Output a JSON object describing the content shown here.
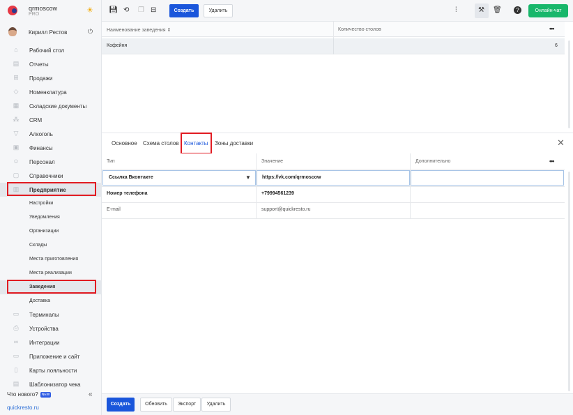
{
  "app": {
    "name": "qrmoscow",
    "plan": "PRO"
  },
  "user": {
    "name": "Кирилл Рестов"
  },
  "sidebar": {
    "items": [
      {
        "label": "Рабочий стол",
        "icon": "home-icon"
      },
      {
        "label": "Отчеты",
        "icon": "chart-icon"
      },
      {
        "label": "Продажи",
        "icon": "cart-icon"
      },
      {
        "label": "Номенклатура",
        "icon": "tag-icon"
      },
      {
        "label": "Складские документы",
        "icon": "warehouse-icon"
      },
      {
        "label": "CRM",
        "icon": "people-icon"
      },
      {
        "label": "Алкоголь",
        "icon": "glass-icon"
      },
      {
        "label": "Финансы",
        "icon": "wallet-icon"
      },
      {
        "label": "Персонал",
        "icon": "staff-icon"
      },
      {
        "label": "Справочники",
        "icon": "book-icon"
      },
      {
        "label": "Предприятие",
        "icon": "building-icon"
      }
    ],
    "subitems": [
      "Настройки",
      "Уведомления",
      "Организации",
      "Склады",
      "Места приготовления",
      "Места реализации",
      "Заведения",
      "Доставка"
    ],
    "items2": [
      {
        "label": "Терминалы",
        "icon": "terminal-icon"
      },
      {
        "label": "Устройства",
        "icon": "printer-icon"
      },
      {
        "label": "Интеграции",
        "icon": "link-icon"
      },
      {
        "label": "Приложение и сайт",
        "icon": "monitor-icon"
      },
      {
        "label": "Карты лояльности",
        "icon": "card-icon"
      },
      {
        "label": "Шаблонизатор чека",
        "icon": "receipt-icon"
      }
    ],
    "whats_new": "Что нового?",
    "new_badge": "NEW",
    "site": "quickresto.ru"
  },
  "toolbar": {
    "create": "Создать",
    "delete": "Удалить",
    "chat": "Онлайн-чат"
  },
  "grid": {
    "col1": "Наименование заведения ⇕",
    "col2": "Количество столов",
    "row_name": "Кофейня",
    "row_tables": "6"
  },
  "tabs": [
    "Основное",
    "Схема столов",
    "Контакты",
    "Зоны доставки"
  ],
  "contacts": {
    "headers": [
      "Тип",
      "Значение",
      "Дополнительно"
    ],
    "rows": [
      {
        "type": "Ссылка Вконтакте",
        "value": "https://vk.com/qrmoscow",
        "extra": ""
      },
      {
        "type": "Номер телефона",
        "value": "+79994561239",
        "extra": ""
      },
      {
        "type": "E-mail",
        "value": "support@quickresto.ru",
        "extra": ""
      }
    ]
  },
  "bottom": {
    "create": "Создать",
    "refresh": "Обновить",
    "export": "Экспорт",
    "delete": "Удалить"
  },
  "colors": {
    "accent": "#1a56db",
    "green": "#18b76b",
    "highlight": "#e11b22"
  }
}
